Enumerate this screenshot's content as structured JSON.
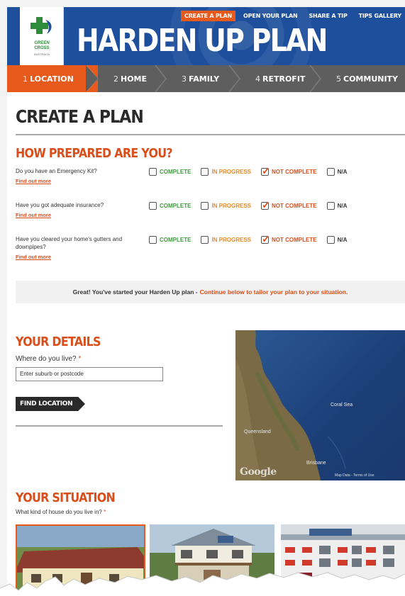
{
  "header": {
    "logo_lines": [
      "GREEN",
      "CROSS",
      "AUSTRALIA"
    ],
    "brand": "HARDEN UP PLAN",
    "top_nav": [
      {
        "label": "CREATE A PLAN",
        "active": true
      },
      {
        "label": "OPEN YOUR PLAN",
        "active": false
      },
      {
        "label": "SHARE A TIP",
        "active": false
      },
      {
        "label": "TIPS GALLERY",
        "active": false
      }
    ]
  },
  "steps": [
    {
      "num": "1",
      "label": "LOCATION",
      "active": true
    },
    {
      "num": "2",
      "label": "HOME",
      "active": false
    },
    {
      "num": "3",
      "label": "FAMILY",
      "active": false
    },
    {
      "num": "4",
      "label": "RETROFIT",
      "active": false
    },
    {
      "num": "5",
      "label": "COMMUNITY",
      "active": false
    }
  ],
  "page_title": "CREATE A PLAN",
  "prepared": {
    "title": "HOW PREPARED ARE YOU?",
    "options": [
      "COMPLETE",
      "IN PROGRESS",
      "NOT COMPLETE",
      "N/A"
    ],
    "questions": [
      {
        "text": "Do you have an Emergency Kit?",
        "more": "Find out more",
        "selected": "NOT COMPLETE"
      },
      {
        "text": "Have you got adequate insurance?",
        "more": "Find out more",
        "selected": "NOT COMPLETE"
      },
      {
        "text": "Have you cleared your home's gutters and downpipes?",
        "more": "Find out more",
        "selected": "NOT COMPLETE"
      }
    ]
  },
  "notice": {
    "text": "Great! You've started your Harden Up plan -",
    "link": "Continue below to tailor your plan to your situation."
  },
  "details": {
    "title": "YOUR DETAILS",
    "label": "Where do you live?",
    "required": "*",
    "input_value": "Enter suburb or postcode",
    "button": "FIND LOCATION"
  },
  "map": {
    "labels": {
      "coral_sea": "Coral Sea",
      "queensland": "Queensland",
      "brisbane": "Brisbane"
    },
    "google": "Google",
    "footer": "Map Data - Terms of Use"
  },
  "situation": {
    "title": "YOUR SITUATION",
    "label": "What kind of house do you live in?",
    "required": "*"
  },
  "colors": {
    "brand_blue": "#1d4f9c",
    "accent_orange": "#e85a1c",
    "step_gray": "#5e5e5e"
  }
}
